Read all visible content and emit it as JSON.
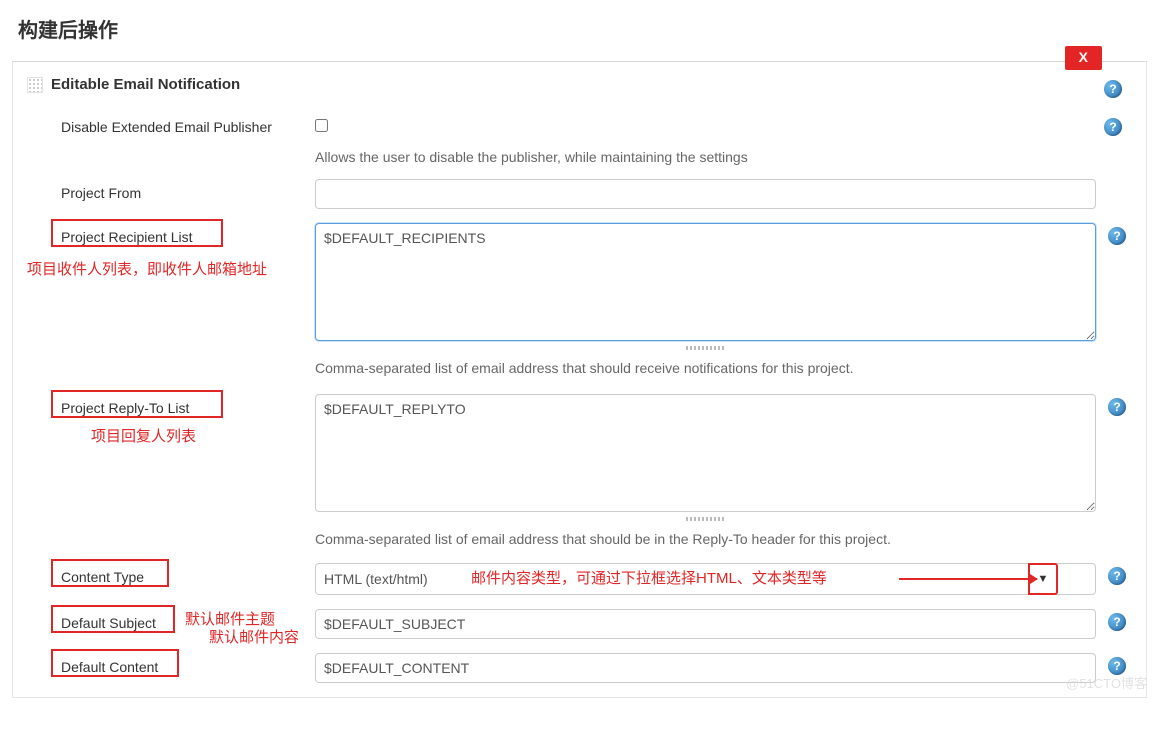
{
  "section_title": "构建后操作",
  "step_title": "Editable Email Notification",
  "delete_label": "X",
  "fields": {
    "disable_publisher": {
      "label": "Disable Extended Email Publisher",
      "hint": "Allows the user to disable the publisher, while maintaining the settings"
    },
    "project_from": {
      "label": "Project From",
      "value": ""
    },
    "recipient_list": {
      "label": "Project Recipient List",
      "value": "$DEFAULT_RECIPIENTS",
      "hint": "Comma-separated list of email address that should receive notifications for this project."
    },
    "reply_to_list": {
      "label": "Project Reply-To List",
      "value": "$DEFAULT_REPLYTO",
      "hint": "Comma-separated list of email address that should be in the Reply-To header for this project."
    },
    "content_type": {
      "label": "Content Type",
      "value": "HTML (text/html)"
    },
    "default_subject": {
      "label": "Default Subject",
      "value": "$DEFAULT_SUBJECT"
    },
    "default_content": {
      "label": "Default Content",
      "value": "$DEFAULT_CONTENT"
    }
  },
  "annotations": {
    "recipient_note": "项目收件人列表，即收件人邮箱地址",
    "reply_note": "项目回复人列表",
    "content_type_note": "邮件内容类型，可通过下拉框选择HTML、文本类型等",
    "subject_note": "默认邮件主题",
    "content_note": "默认邮件内容"
  },
  "watermark": "@51CTO博客"
}
